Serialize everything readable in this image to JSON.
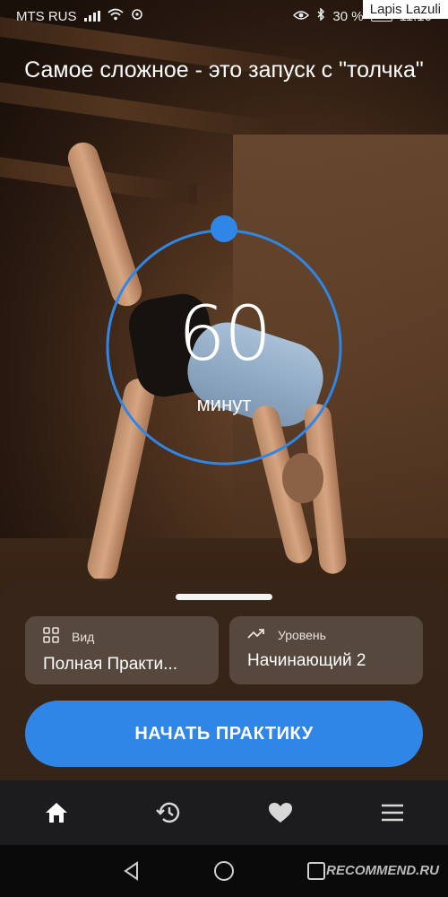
{
  "status_bar": {
    "carrier": "MTS RUS",
    "battery": "30 %",
    "time": "11:10",
    "watermark": "Lapis Lazuli"
  },
  "title": "Самое сложное - это запуск с \"толчка\"",
  "dial": {
    "value": "60",
    "unit": "минут",
    "accent": "#2f86e6"
  },
  "cards": {
    "view": {
      "label": "Вид",
      "value": "Полная Практи...",
      "icon": "grid-icon"
    },
    "level": {
      "label": "Уровень",
      "value": "Начинающий 2",
      "icon": "trending-up-icon"
    }
  },
  "start_button": {
    "label": "НАЧАТЬ ПРАКТИКУ",
    "color": "#2f86e6"
  },
  "tab_bar": {
    "tabs": [
      {
        "icon": "home-icon",
        "active": true
      },
      {
        "icon": "history-icon",
        "active": false
      },
      {
        "icon": "heart-icon",
        "active": false
      },
      {
        "icon": "menu-icon",
        "active": false
      }
    ]
  },
  "system_nav": [
    "back-icon",
    "home-circle-icon",
    "recents-icon"
  ],
  "corner_mark": "RECOMMEND.RU"
}
